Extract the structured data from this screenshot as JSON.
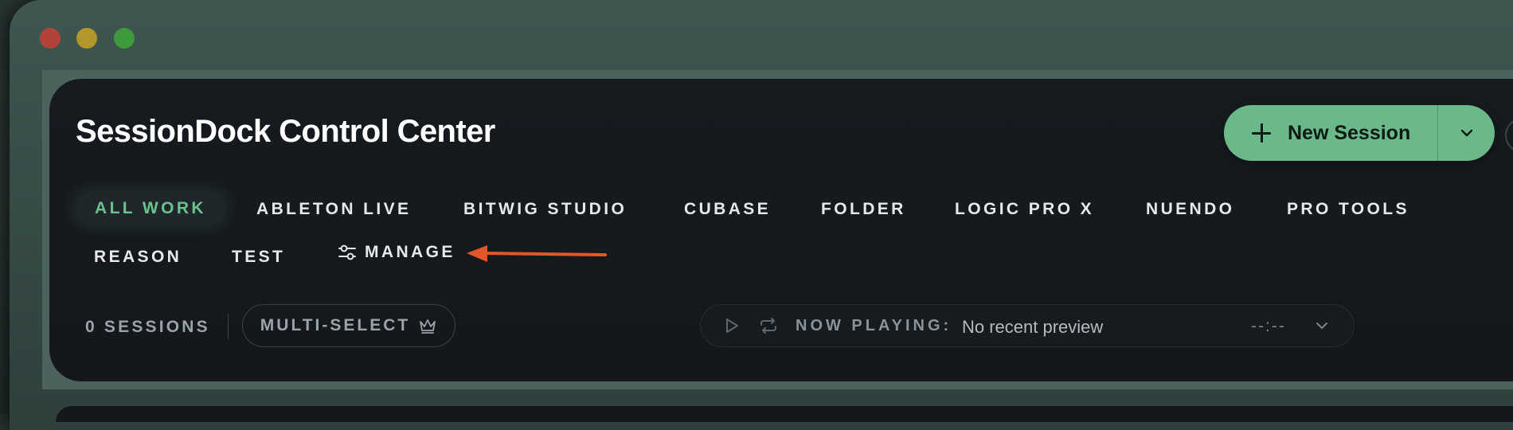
{
  "header": {
    "title": "SessionDock Control Center",
    "new_session_label": "New Session",
    "new_session_icon": "plus-icon",
    "dropdown_icon": "chevron-down-icon"
  },
  "tabs": {
    "row1": [
      "ALL WORK",
      "ABLETON LIVE",
      "BITWIG STUDIO",
      "CUBASE",
      "FOLDER",
      "LOGIC PRO X",
      "NUENDO",
      "PRO TOOLS"
    ],
    "row2": [
      "REASON",
      "TEST"
    ],
    "active": "ALL WORK",
    "manage_label": "MANAGE",
    "manage_icon": "sliders-icon"
  },
  "toolbar": {
    "sessions_count": "0 SESSIONS",
    "multi_select_label": "MULTI-SELECT",
    "multi_select_icon": "crown-icon"
  },
  "player": {
    "now_playing_label": "NOW PLAYING:",
    "now_playing_value": "No recent preview",
    "time": "--:--",
    "play_icon": "play-icon",
    "repeat_icon": "repeat-icon",
    "expand_icon": "chevron-down-icon"
  },
  "colors": {
    "accent": "#6bb88a",
    "active_tab_text": "#6bc28e",
    "annotation_arrow": "#e0582a",
    "panel_bg": "#14181c"
  }
}
